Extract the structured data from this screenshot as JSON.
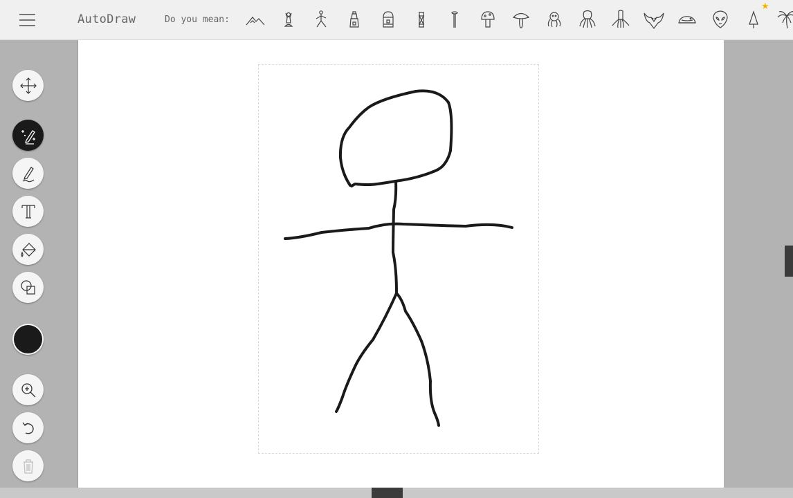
{
  "app": {
    "title": "AutoDraw"
  },
  "suggestions": {
    "label": "Do you mean:",
    "items": [
      {
        "icon": "mountains-icon"
      },
      {
        "icon": "yoga-figure-icon"
      },
      {
        "icon": "yoga-pose-icon"
      },
      {
        "icon": "lighthouse-icon"
      },
      {
        "icon": "jar-icon"
      },
      {
        "icon": "lantern-icon"
      },
      {
        "icon": "nail-icon"
      },
      {
        "icon": "mushroom-icon"
      },
      {
        "icon": "mushroom-cap-icon"
      },
      {
        "icon": "octopus-icon"
      },
      {
        "icon": "octopus-tentacles-icon"
      },
      {
        "icon": "squid-icon"
      },
      {
        "icon": "bat-icon"
      },
      {
        "icon": "whale-icon"
      },
      {
        "icon": "alien-icon"
      },
      {
        "icon": "tree-icon"
      },
      {
        "icon": "palm-tree-icon"
      }
    ],
    "badge_icon": "star-icon",
    "badge_color": "#f5b400"
  },
  "toolbar": {
    "tools": [
      {
        "name": "select-tool",
        "icon": "move-arrows-icon"
      },
      {
        "name": "autodraw-tool",
        "icon": "autodraw-magic-pen-icon",
        "active": true
      },
      {
        "name": "draw-tool",
        "icon": "pencil-icon"
      },
      {
        "name": "type-tool",
        "icon": "text-icon"
      },
      {
        "name": "fill-tool",
        "icon": "paint-bucket-icon"
      },
      {
        "name": "shape-tool",
        "icon": "shapes-icon"
      },
      {
        "name": "zoom-tool",
        "icon": "zoom-in-icon"
      },
      {
        "name": "undo-tool",
        "icon": "undo-icon"
      },
      {
        "name": "delete-tool",
        "icon": "trash-icon"
      }
    ],
    "current_color": "#1a1a1a"
  },
  "canvas": {
    "background": "#ffffff",
    "drawing_color": "#1a1a1a"
  }
}
